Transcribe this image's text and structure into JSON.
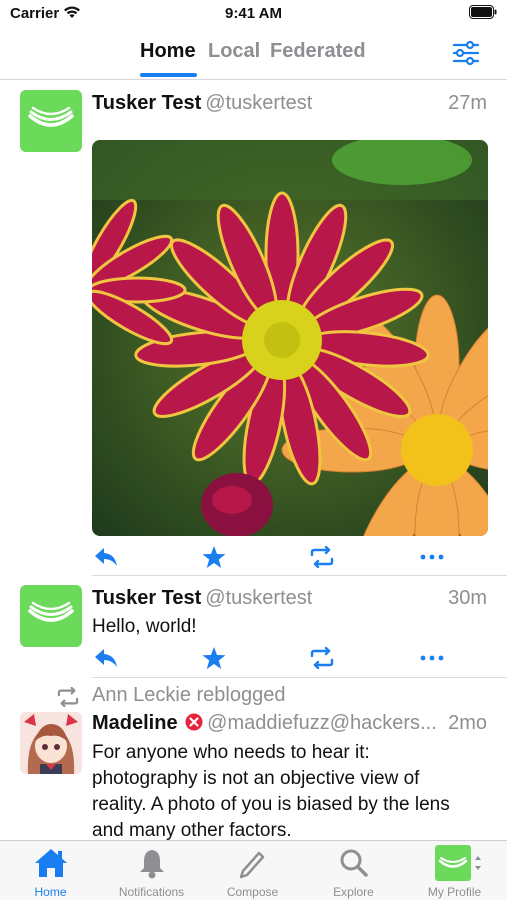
{
  "status_bar": {
    "carrier": "Carrier",
    "time": "9:41 AM"
  },
  "header": {
    "tabs": [
      {
        "label": "Home",
        "active": true
      },
      {
        "label": "Local",
        "active": false
      },
      {
        "label": "Federated",
        "active": false
      }
    ]
  },
  "posts": [
    {
      "display_name": "Tusker Test",
      "handle": "@tuskertest",
      "time": "27m",
      "has_image": true,
      "image_description": "photo of red-yellow and orange daisy flowers"
    },
    {
      "display_name": "Tusker Test",
      "handle": "@tuskertest",
      "time": "30m",
      "text": "Hello, world!"
    },
    {
      "reblogged_by": "Ann Leckie reblogged",
      "display_name": "Madeline",
      "handle": "@maddiefuzz@hackers...",
      "time": "2mo",
      "text_lines": [
        "For anyone who needs to hear it:",
        "photography is not an objective view of",
        "reality. A photo of you is biased by the lens",
        "and many other factors."
      ]
    }
  ],
  "tab_bar": {
    "items": [
      {
        "label": "Home",
        "icon": "house-icon",
        "active": true
      },
      {
        "label": "Notifications",
        "icon": "bell-icon",
        "active": false
      },
      {
        "label": "Compose",
        "icon": "pencil-icon",
        "active": false
      },
      {
        "label": "Explore",
        "icon": "magnifier-icon",
        "active": false
      },
      {
        "label": "My Profile",
        "icon": "profile-avatar-icon",
        "active": false
      }
    ]
  },
  "colors": {
    "accent": "#1b7ef0",
    "avatar_green": "#6bd95a",
    "secondary_text": "#8e8e93",
    "badge_red": "#e5243b"
  }
}
